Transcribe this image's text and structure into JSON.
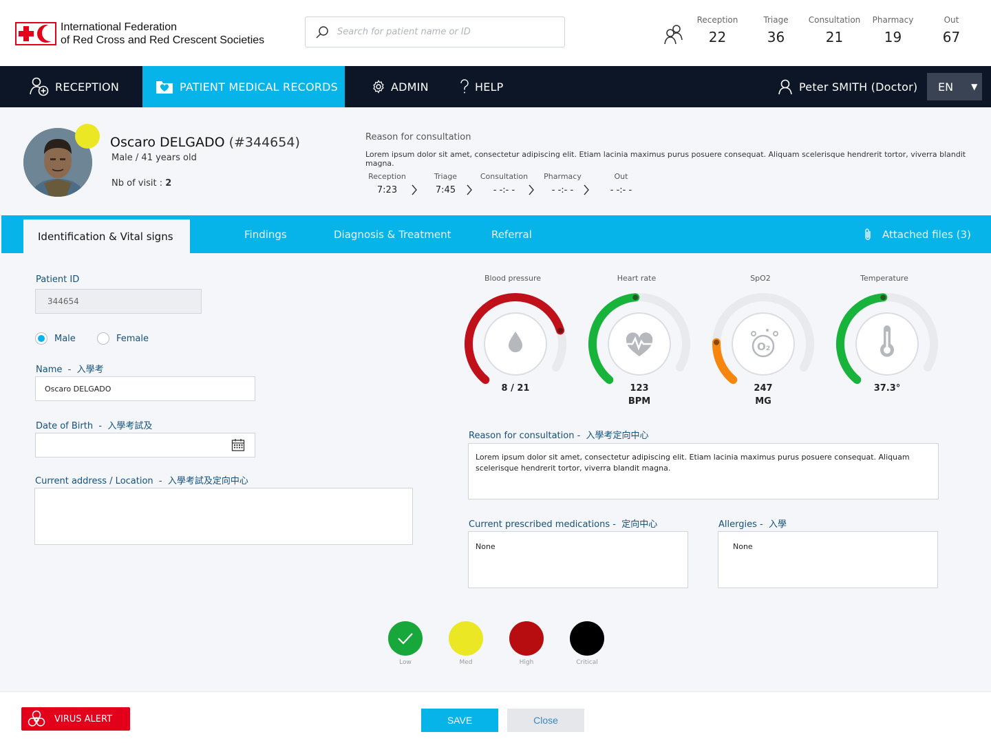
{
  "header": {
    "org_line1": "International Federation",
    "org_line2": "of Red Cross and Red Crescent Societies",
    "search_placeholder": "Search for patient name or ID",
    "stats": [
      {
        "label": "Reception",
        "value": "22"
      },
      {
        "label": "Triage",
        "value": "36"
      },
      {
        "label": "Consultation",
        "value": "21"
      },
      {
        "label": "Pharmacy",
        "value": "19"
      },
      {
        "label": "Out",
        "value": "67"
      }
    ]
  },
  "nav": {
    "reception": "RECEPTION",
    "records": "PATIENT MEDICAL RECORDS",
    "admin": "ADMIN",
    "help": "HELP",
    "user": "Peter SMITH (Doctor)",
    "lang": "EN"
  },
  "patient": {
    "name": "Oscaro DELGADO",
    "id_label": "(#344654)",
    "sub": "Male / 41 years old",
    "visit_label": "Nb of visit : ",
    "visit_count": "2",
    "status_color": "#ebe725",
    "rfc_title": "Reason for consultation",
    "rfc_text": "Lorem ipsum dolor sit amet, consectetur adipiscing elit. Etiam lacinia maximus purus posuere consequat. Aliquam scelerisque hendrerit tortor, viverra blandit magna.",
    "timeline": [
      {
        "label": "Reception",
        "value": "7:23"
      },
      {
        "label": "Triage",
        "value": "7:45"
      },
      {
        "label": "Consultation",
        "value": "- -:- -"
      },
      {
        "label": "Pharmacy",
        "value": "- -:- -"
      },
      {
        "label": "Out",
        "value": "- -:- -"
      }
    ]
  },
  "tabs": {
    "ident": "Identification & Vital signs",
    "findings": "Findings",
    "diagnosis": "Diagnosis & Treatment",
    "referral": "Referral",
    "attached": "Attached files (3)"
  },
  "form": {
    "patient_id_label": "Patient ID",
    "patient_id_value": "344654",
    "male": "Male",
    "female": "Female",
    "name_label": "Name",
    "name_alt": "入學考",
    "name_value": "Oscaro DELGADO",
    "dob_label": "Date of Birth",
    "dob_alt": "入學考試及",
    "address_label": "Current address / Location",
    "address_alt": "入學考試及定向中心",
    "rfc_label": "Reason for consultation -",
    "rfc_alt": "入學考定向中心",
    "rfc_value": "Lorem ipsum dolor sit amet, consectetur adipiscing elit. Etiam lacinia maximus purus posuere consequat. Aliquam scelerisque hendrerit tortor, viverra blandit magna.",
    "meds_label": "Current prescribed medications -",
    "meds_alt": "定向中心",
    "meds_value": "None",
    "allergies_label": "Allergies -",
    "allergies_alt": "入學",
    "allergies_value": "None"
  },
  "vitals": [
    {
      "title": "Blood pressure",
      "value": "8 / 21",
      "unit": "",
      "fraction": 0.82,
      "color": "#c0101a",
      "icon": "drop-icon"
    },
    {
      "title": "Heart rate",
      "value": "123",
      "unit": "BPM",
      "fraction": 0.52,
      "color": "#17b33b",
      "icon": "heart-pulse-icon"
    },
    {
      "title": "SpO2",
      "value": "247",
      "unit": "MG",
      "fraction": 0.2,
      "color": "#f7860f",
      "icon": "oxygen-icon"
    },
    {
      "title": "Temperature",
      "value": "37.3°",
      "unit": "",
      "fraction": 0.52,
      "color": "#17b33b",
      "icon": "thermometer-icon"
    }
  ],
  "severity": [
    {
      "label": "Low",
      "color": "#17a73a"
    },
    {
      "label": "Med",
      "color": "#ebe725"
    },
    {
      "label": "High",
      "color": "#b80d10"
    },
    {
      "label": "Critical",
      "color": "#000000"
    }
  ],
  "footer": {
    "virus": "VIRUS ALERT",
    "save": "SAVE",
    "close": "Close"
  }
}
